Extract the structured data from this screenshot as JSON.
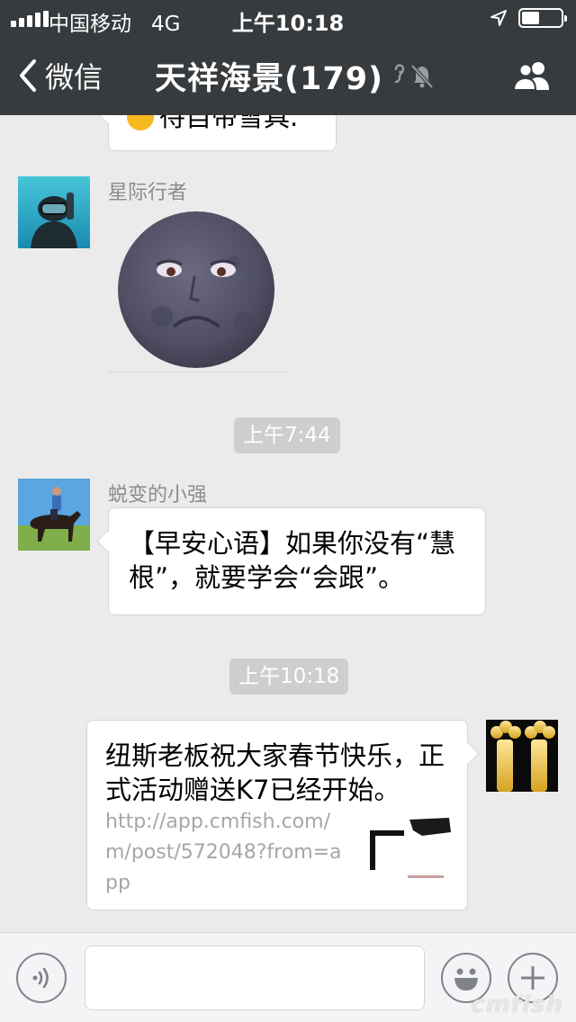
{
  "status_bar": {
    "carrier": "中国移动",
    "network": "4G",
    "time": "上午10:18",
    "battery_level": 0.45
  },
  "nav": {
    "back_label": "微信",
    "title": "天祥海景(179)",
    "icons": [
      "chevron-left-icon",
      "mute-bell-icon",
      "group-members-icon"
    ]
  },
  "messages": {
    "partial_top_text": "待自带雪具.",
    "m1_sender": "星际行者",
    "m1_sticker": "sad-moon-sticker",
    "ts1": "上午7:44",
    "m2_sender": "蜕变的小强",
    "m2_text": "【早安心语】如果你没有“慧根”，就要学会“会跟”。",
    "ts2": "上午10:18",
    "m3_text": "纽斯老板祝大家春节快乐，正式活动赠送K7已经开始。",
    "m3_link": "http://app.cmfish.com/m/post/572048?from=app"
  },
  "input_bar": {
    "voice_icon": "voice-icon",
    "emoji_icon": "emoji-icon",
    "plus_icon": "plus-icon",
    "placeholder": "",
    "watermark": "cmfish"
  },
  "colors": {
    "nav_bg": "#373b3e",
    "chat_bg": "#ebebeb",
    "bubble_bg": "#ffffff",
    "timestamp_bg": "#cecece"
  }
}
